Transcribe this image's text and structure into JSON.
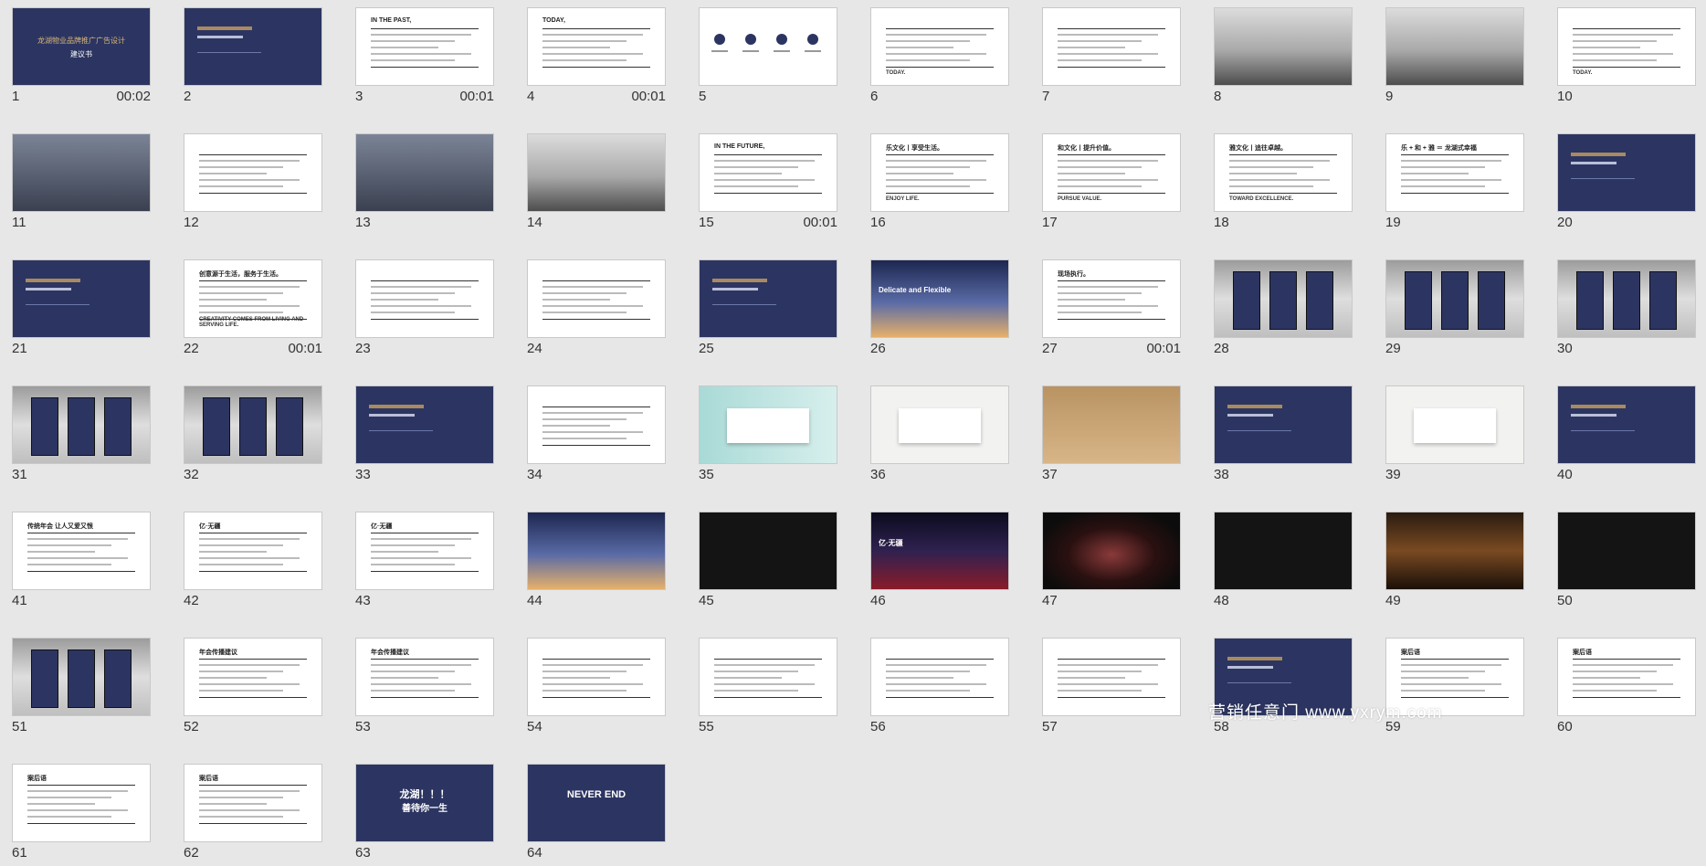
{
  "slides": [
    {
      "num": "1",
      "duration": "00:02",
      "style": "navy-title",
      "title": "龙湖物业品牌推广广告设计",
      "subtitle": "建议书"
    },
    {
      "num": "2",
      "duration": "",
      "style": "navy",
      "title": "",
      "subtitle": ""
    },
    {
      "num": "3",
      "duration": "00:01",
      "style": "text",
      "title": "IN THE PAST,",
      "subtitle": ""
    },
    {
      "num": "4",
      "duration": "00:01",
      "style": "text",
      "title": "TODAY,",
      "subtitle": ""
    },
    {
      "num": "5",
      "duration": "",
      "style": "icons",
      "title": "",
      "subtitle": ""
    },
    {
      "num": "6",
      "duration": "",
      "style": "text",
      "title": "",
      "subtitle": "TODAY."
    },
    {
      "num": "7",
      "duration": "",
      "style": "text",
      "title": "",
      "subtitle": ""
    },
    {
      "num": "8",
      "duration": "",
      "style": "city",
      "title": "",
      "subtitle": ""
    },
    {
      "num": "9",
      "duration": "",
      "style": "city",
      "title": "",
      "subtitle": ""
    },
    {
      "num": "10",
      "duration": "",
      "style": "text",
      "title": "",
      "subtitle": "TODAY."
    },
    {
      "num": "11",
      "duration": "",
      "style": "photo",
      "title": "",
      "subtitle": ""
    },
    {
      "num": "12",
      "duration": "",
      "style": "text",
      "title": "",
      "subtitle": ""
    },
    {
      "num": "13",
      "duration": "",
      "style": "photo",
      "title": "",
      "subtitle": ""
    },
    {
      "num": "14",
      "duration": "",
      "style": "city",
      "title": "",
      "subtitle": ""
    },
    {
      "num": "15",
      "duration": "00:01",
      "style": "text",
      "title": "IN THE FUTURE,",
      "subtitle": ""
    },
    {
      "num": "16",
      "duration": "",
      "style": "text",
      "title": "乐文化丨享受生活。",
      "subtitle": "ENJOY LIFE."
    },
    {
      "num": "17",
      "duration": "",
      "style": "text",
      "title": "和文化丨提升价值。",
      "subtitle": "PURSUE VALUE."
    },
    {
      "num": "18",
      "duration": "",
      "style": "text",
      "title": "雅文化丨追往卓越。",
      "subtitle": "TOWARD EXCELLENCE."
    },
    {
      "num": "19",
      "duration": "",
      "style": "text",
      "title": "乐 + 和 + 雅 ＝ 龙湖式幸福",
      "subtitle": ""
    },
    {
      "num": "20",
      "duration": "",
      "style": "navy",
      "title": "",
      "subtitle": ""
    },
    {
      "num": "21",
      "duration": "",
      "style": "navy",
      "title": "",
      "subtitle": ""
    },
    {
      "num": "22",
      "duration": "00:01",
      "style": "text",
      "title": "创意源于生活，服务于生活。",
      "subtitle": "CREATIVITY COMES FROM LIVING AND SERVING LIFE."
    },
    {
      "num": "23",
      "duration": "",
      "style": "text",
      "title": "",
      "subtitle": ""
    },
    {
      "num": "24",
      "duration": "",
      "style": "text",
      "title": "",
      "subtitle": ""
    },
    {
      "num": "25",
      "duration": "",
      "style": "navy",
      "title": "",
      "subtitle": ""
    },
    {
      "num": "26",
      "duration": "",
      "style": "cityn",
      "title": "Delicate and Flexible",
      "subtitle": ""
    },
    {
      "num": "27",
      "duration": "00:01",
      "style": "text",
      "title": "现场执行。",
      "subtitle": ""
    },
    {
      "num": "28",
      "duration": "",
      "style": "grey3d",
      "title": "",
      "subtitle": ""
    },
    {
      "num": "29",
      "duration": "",
      "style": "grey3d",
      "title": "",
      "subtitle": ""
    },
    {
      "num": "30",
      "duration": "",
      "style": "grey3d",
      "title": "",
      "subtitle": ""
    },
    {
      "num": "31",
      "duration": "",
      "style": "grey3d",
      "title": "",
      "subtitle": ""
    },
    {
      "num": "32",
      "duration": "",
      "style": "grey3d",
      "title": "",
      "subtitle": ""
    },
    {
      "num": "33",
      "duration": "",
      "style": "navy",
      "title": "",
      "subtitle": ""
    },
    {
      "num": "34",
      "duration": "",
      "style": "text",
      "title": "",
      "subtitle": ""
    },
    {
      "num": "35",
      "duration": "",
      "style": "mint",
      "title": "",
      "subtitle": ""
    },
    {
      "num": "36",
      "duration": "",
      "style": "paper",
      "title": "",
      "subtitle": ""
    },
    {
      "num": "37",
      "duration": "",
      "style": "bag",
      "title": "",
      "subtitle": ""
    },
    {
      "num": "38",
      "duration": "",
      "style": "navy",
      "title": "",
      "subtitle": ""
    },
    {
      "num": "39",
      "duration": "",
      "style": "paper",
      "title": "",
      "subtitle": ""
    },
    {
      "num": "40",
      "duration": "",
      "style": "navy",
      "title": "",
      "subtitle": ""
    },
    {
      "num": "41",
      "duration": "",
      "style": "text",
      "title": "传统年会 让人又爱又恨",
      "subtitle": ""
    },
    {
      "num": "42",
      "duration": "",
      "style": "text",
      "title": "亿·无疆",
      "subtitle": ""
    },
    {
      "num": "43",
      "duration": "",
      "style": "text",
      "title": "亿·无疆",
      "subtitle": ""
    },
    {
      "num": "44",
      "duration": "",
      "style": "cityn",
      "title": "",
      "subtitle": ""
    },
    {
      "num": "45",
      "duration": "",
      "style": "dark",
      "title": "",
      "subtitle": ""
    },
    {
      "num": "46",
      "duration": "",
      "style": "stagefx",
      "title": "亿·无疆",
      "subtitle": ""
    },
    {
      "num": "47",
      "duration": "",
      "style": "stage",
      "title": "",
      "subtitle": ""
    },
    {
      "num": "48",
      "duration": "",
      "style": "dark",
      "title": "",
      "subtitle": ""
    },
    {
      "num": "49",
      "duration": "",
      "style": "hall",
      "title": "",
      "subtitle": ""
    },
    {
      "num": "50",
      "duration": "",
      "style": "dark",
      "title": "",
      "subtitle": ""
    },
    {
      "num": "51",
      "duration": "",
      "style": "grey3d",
      "title": "",
      "subtitle": ""
    },
    {
      "num": "52",
      "duration": "",
      "style": "text",
      "title": "年会传播建议",
      "subtitle": ""
    },
    {
      "num": "53",
      "duration": "",
      "style": "text",
      "title": "年会传播建议",
      "subtitle": ""
    },
    {
      "num": "54",
      "duration": "",
      "style": "text",
      "title": "",
      "subtitle": ""
    },
    {
      "num": "55",
      "duration": "",
      "style": "text",
      "title": "",
      "subtitle": ""
    },
    {
      "num": "56",
      "duration": "",
      "style": "text",
      "title": "",
      "subtitle": ""
    },
    {
      "num": "57",
      "duration": "",
      "style": "text",
      "title": "",
      "subtitle": ""
    },
    {
      "num": "58",
      "duration": "",
      "style": "navy",
      "title": "",
      "subtitle": ""
    },
    {
      "num": "59",
      "duration": "",
      "style": "text",
      "title": "案后语",
      "subtitle": ""
    },
    {
      "num": "60",
      "duration": "",
      "style": "text",
      "title": "案后语",
      "subtitle": ""
    },
    {
      "num": "61",
      "duration": "",
      "style": "text",
      "title": "案后语",
      "subtitle": ""
    },
    {
      "num": "62",
      "duration": "",
      "style": "text",
      "title": "案后语",
      "subtitle": ""
    },
    {
      "num": "63",
      "duration": "",
      "style": "navy-center",
      "title": "龙湖！！！",
      "subtitle": "善待你一生"
    },
    {
      "num": "64",
      "duration": "",
      "style": "navy-center",
      "title": "NEVER END",
      "subtitle": ""
    }
  ],
  "watermark": "营销任意门 www.yxrym.com",
  "colors": {
    "navy": "#2c3561",
    "background": "#e7e7e7",
    "accent": "#c0392b"
  }
}
